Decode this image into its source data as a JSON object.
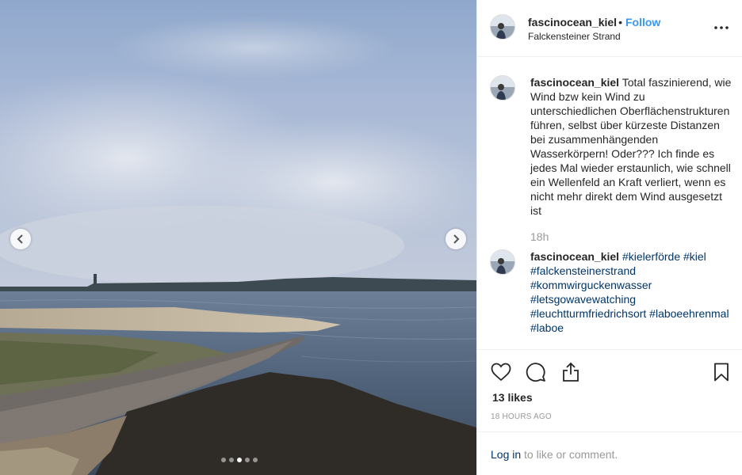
{
  "post": {
    "username": "fascinocean_kiel",
    "separator": "•",
    "follow_label": "Follow",
    "location": "Falckensteiner Strand",
    "more_icon": "more-horizontal-icon",
    "caption": "Total faszinierend, wie Wind bzw kein Wind zu unterschiedlichen Oberflächenstrukturen führen, selbst über kürzeste Distanzen bei zusammenhängenden Wasserkörpern! Oder??? Ich finde es jedes Mal wieder erstaunlich, wie schnell ein Wellenfeld an Kraft verliert, wenn es nicht mehr direkt dem Wind ausgesetzt ist",
    "caption_age": "18h",
    "hashtags": [
      "#kielerförde",
      "#kiel",
      "#falckensteinerstrand",
      "#kommwirguckenwasser",
      "#letsgowavewatching",
      "#leuchtturmfriedrichsort",
      "#laboeehrenmal",
      "#laboe"
    ],
    "likes": "13 likes",
    "time": "18 HOURS AGO"
  },
  "carousel": {
    "total_slides": 5,
    "active_slide": 3,
    "prev_icon": "chevron-left-icon",
    "next_icon": "chevron-right-icon"
  },
  "actions": {
    "like_icon": "heart-icon",
    "comment_icon": "comment-icon",
    "share_icon": "share-icon",
    "save_icon": "bookmark-icon"
  },
  "login": {
    "link_label": "Log in",
    "suffix": "to like or comment."
  },
  "colors": {
    "link_blue": "#3897f0",
    "hashtag_blue": "#003569",
    "muted_gray": "#999999",
    "text": "#262626"
  }
}
